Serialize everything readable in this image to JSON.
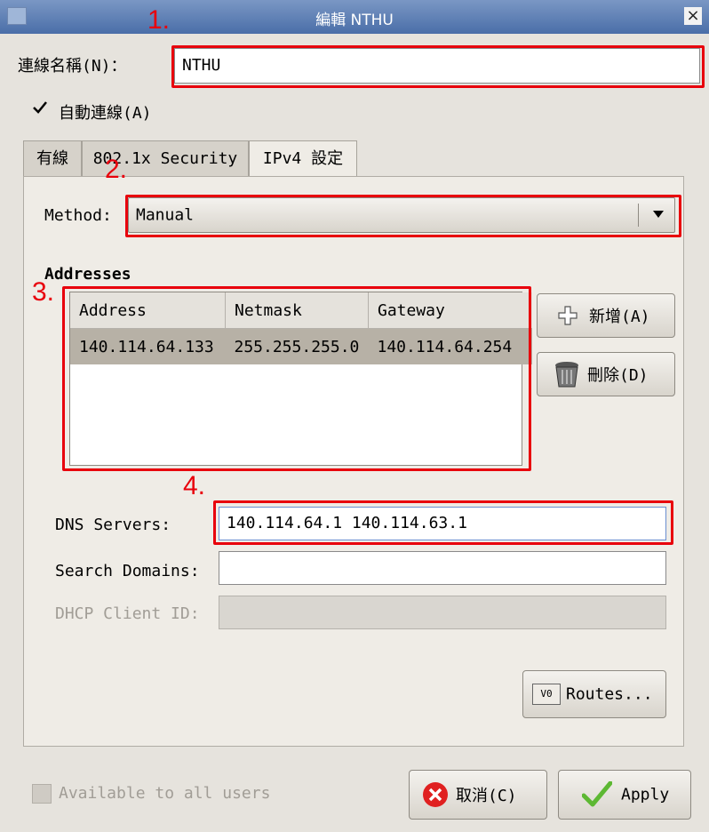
{
  "window": {
    "title": "編輯 NTHU",
    "close_glyph": "×"
  },
  "connection": {
    "name_label": "連線名稱(N)：",
    "name_value": "NTHU",
    "auto_connect_label": "自動連線(A)"
  },
  "tabs": [
    {
      "label": "有線"
    },
    {
      "label": "802.1x Security"
    },
    {
      "label": "IPv4 設定"
    }
  ],
  "method": {
    "label": "Method:",
    "value": "Manual"
  },
  "addresses": {
    "heading": "Addresses",
    "columns": [
      "Address",
      "Netmask",
      "Gateway"
    ],
    "rows": [
      [
        "140.114.64.133",
        "255.255.255.0",
        "140.114.64.254"
      ]
    ],
    "add_label": "新增(A)",
    "delete_label": "刪除(D)"
  },
  "dns": {
    "label": "DNS Servers:",
    "value": "140.114.64.1 140.114.63.1"
  },
  "search_domains": {
    "label": "Search Domains:",
    "value": ""
  },
  "dhcp_client_id": {
    "label": "DHCP Client ID:",
    "value": ""
  },
  "routes_label": "Routes...",
  "routes_icon_text": "V0",
  "available_to_all_label": "Available to all users",
  "cancel_label": "取消(C)",
  "apply_label": "Apply",
  "annotations": [
    "1.",
    "2.",
    "3.",
    "4."
  ],
  "colors": {
    "annotation_red": "#e8000c",
    "titlebar": "#5a7db3",
    "selected_row": "#b7b1a6"
  }
}
